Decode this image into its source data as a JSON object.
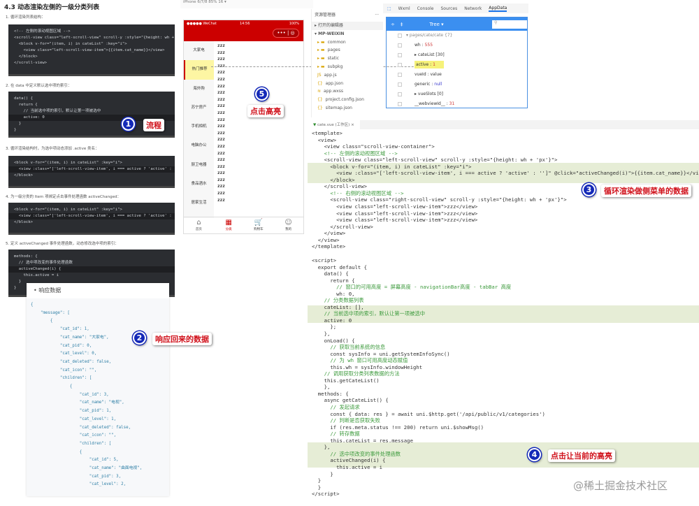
{
  "doc": {
    "title": "4.3 动态渲染左侧的一级分类列表",
    "steps": [
      "1. 循环渲染列表结构：",
      "2. 在 data 中定义默认选中项的索引：",
      "3. 循环渲染结构时，为选中项动态添加 .active 类名：",
      "4. 为一级分类的 Item 项绑定点击事件处理函数 activeChanged：",
      "5. 定义 activeChanged 事件处理函数，动态修改选中项的索引："
    ],
    "block1": [
      "<!-- 左侧的滚动视图区域 -->",
      "<scroll-view class=\"left-scroll-view\" scroll-y :style=\"{height: wh +",
      "  <block v-for=\"(item, i) in cateList\" :key=\"i\">",
      "    <view class=\"left-scroll-view-item\">{{item.cat_name}}</view>",
      "  </block>",
      "</scroll-view>"
    ],
    "block2": [
      "data() {",
      "  return {",
      "    // 当前选中项的索引，默认让第一项被选中",
      "    active: 0",
      "  }",
      "}"
    ],
    "block3": [
      "<block v-for=\"(item, i) in cateList\" :key=\"i\">",
      "  <view :class=\"['left-scroll-view-item', i === active ? 'active' :",
      "</block>"
    ],
    "block4": [
      "<block v-for=\"(item, i) in cateList\" :key=\"i\">",
      "  <view :class=\"['left-scroll-view-item', i === active ? 'active' :",
      "</block>"
    ],
    "block5": [
      "methods: {",
      "  // 选中项改变的事件处理函数",
      "  activeChanged(i) {",
      "    this.active = i",
      "  }",
      "}"
    ]
  },
  "response": {
    "title": "响应数据",
    "lines": [
      "{",
      "    \"message\": [",
      "        {",
      "            \"cat_id\": 1,",
      "            \"cat_name\": \"大家电\",",
      "            \"cat_pid\": 0,",
      "            \"cat_level\": 0,",
      "            \"cat_deleted\": false,",
      "            \"cat_icon\": \"\",",
      "            \"children\": [",
      "                {",
      "                    \"cat_id\": 3,",
      "                    \"cat_name\": \"电视\",",
      "                    \"cat_pid\": 1,",
      "                    \"cat_level\": 1,",
      "                    \"cat_deleted\": false,",
      "                    \"cat_icon\": \"\",",
      "                    \"children\": [",
      "                    {",
      "                        \"cat_id\": 5,",
      "                        \"cat_name\": \"曲面电视\",",
      "                        \"cat_pid\": 3,",
      "                        \"cat_level\": 2,"
    ]
  },
  "annotations": [
    {
      "num": "1",
      "label": "流程"
    },
    {
      "num": "2",
      "label": "响应回来的数据"
    },
    {
      "num": "3",
      "label": "循环渲染做侧菜单的数据"
    },
    {
      "num": "4",
      "label": "点击让当前的高亮"
    },
    {
      "num": "5",
      "label": "点击高亮"
    }
  ],
  "simulator": {
    "device": "iPhone 6/7/8 85% 16 ▾",
    "status_left": "●●●●● WeChat",
    "time": "14:56",
    "battery": "100%",
    "capsule": "••• | ◎",
    "menu": [
      "大家电",
      "热门推荐",
      "海外购",
      "苏宁房产",
      "手机相机",
      "电脑办公",
      "厨卫电器",
      "食品酒水",
      "居家生活"
    ],
    "active_index": 1,
    "zzz": [
      "zzz",
      "zzz",
      "zzz",
      "zzz",
      "zzz",
      "zzz",
      "zzz",
      "zzz",
      "zzz",
      "zzz",
      "zzz",
      "zzz",
      "zzz",
      "zzz",
      "zzz",
      "zzz",
      "zzz",
      "zzz",
      "zzz",
      "zzz",
      "zzz",
      "zzz",
      "zzz",
      "zzz"
    ],
    "tabs": [
      {
        "icon": "⌂",
        "label": "首页"
      },
      {
        "icon": "▦",
        "label": "分类"
      },
      {
        "icon": "🛒",
        "label": "购物车"
      },
      {
        "icon": "☺",
        "label": "我的"
      }
    ]
  },
  "explorer": {
    "title": "资源管理器",
    "more": "···",
    "open_editors": "▸ 打开的编辑器",
    "project": "▾ MP-WEIXIN",
    "items": [
      {
        "icon": "▸ ▬",
        "name": "common"
      },
      {
        "icon": "▸ ▬",
        "name": "pages"
      },
      {
        "icon": "▸ ▬",
        "name": "static"
      },
      {
        "icon": "▸ ▬",
        "name": "subpkg"
      },
      {
        "icon": "  JS",
        "name": "app.js"
      },
      {
        "icon": "  {}",
        "name": "app.json"
      },
      {
        "icon": "  ≋",
        "name": "app.wxss"
      },
      {
        "icon": "  {}",
        "name": "project.config.json"
      },
      {
        "icon": "  {}",
        "name": "sitemap.json"
      }
    ]
  },
  "devtools": {
    "tabs": [
      "Wxml",
      "Console",
      "Sources",
      "Network",
      "AppData"
    ],
    "mode": "Tree ▾",
    "root": "▾ pages/cate/cate {7}",
    "rows": [
      {
        "key": "wh",
        "sep": " : ",
        "val": "555",
        "cls": "num"
      },
      {
        "key": "▸ cateList",
        "sep": " ",
        "val": "[30]",
        "cls": ""
      },
      {
        "key": "active",
        "sep": " : ",
        "val": "1",
        "cls": "num"
      },
      {
        "key": "vueId",
        "sep": " : ",
        "val": "value",
        "cls": ""
      },
      {
        "key": "generic",
        "sep": " : ",
        "val": "null",
        "cls": "kw"
      },
      {
        "key": "▸ vueSlots",
        "sep": " ",
        "val": "[0]",
        "cls": ""
      },
      {
        "key": "__webviewId__",
        "sep": " : ",
        "val": "31",
        "cls": "num"
      }
    ]
  },
  "editor": {
    "tab": "cate.vue (工作区) ×",
    "template": [
      "<template>",
      "  <view>",
      "    <view class=\"scroll-view-container\">",
      "    <!-- 左侧的滚动视图区域 -->",
      "    <scroll-view class=\"left-scroll-view\" scroll-y :style=\"{height: wh + 'px'}\">",
      "      <block v-for=\"(item, i) in cateList\" :key=\"i\">",
      "        <view :class=\"['left-scroll-view-item', i === active ? 'active' : '']\" @click=\"activeChanged(i)\">{{item.cat_name}}</view>",
      "      </block>",
      "    </scroll-view>",
      "      <!-- 右侧的滚动视图区域 -->",
      "      <scroll-view class=\"right-scroll-view\" scroll-y :style=\"{height: wh + 'px'}\">",
      "        <view class=\"left-scroll-view-item\">zzz</view>",
      "        <view class=\"left-scroll-view-item\">zzz</view>",
      "        <view class=\"left-scroll-view-item\">zzz</view>",
      "      </scroll-view>",
      "    </view>",
      "  </view>",
      "</template>"
    ],
    "script": [
      "<script>",
      "  export default {",
      "    data() {",
      "      return {",
      "        // 窗口的可用高度 = 屏幕高度 - navigationBar高度 - tabBar 高度",
      "        wh: 0,",
      "    // 分类数据列表",
      "    cateList: [],",
      "    // 当前选中项的索引，默认让第一项被选中",
      "    active: 0",
      "      };",
      "    },",
      "    onLoad() {",
      "      // 获取当前系统的信息",
      "      const sysInfo = uni.getSystemInfoSync()",
      "      // 为 wh 窗口可用高度动态赋值",
      "      this.wh = sysInfo.windowHeight",
      "    // 调用获取分类列表数据的方法",
      "    this.getCateList()",
      "    },",
      "  methods: {",
      "    async getCateList() {",
      "      // 发起请求",
      "      const { data: res } = await uni.$http.get('/api/public/v1/categories')",
      "      // 判断是否获取失败",
      "      if (res.meta.status !== 200) return uni.$showMsg()",
      "      // 转存数据",
      "      this.cateList = res.message",
      "    },",
      "      // 选中项改变的事件处理函数",
      "      activeChanged(i) {",
      "        this.active = i",
      "      }",
      "  }",
      "  }",
      "</script>"
    ]
  },
  "watermark": "@稀土掘金技术社区"
}
